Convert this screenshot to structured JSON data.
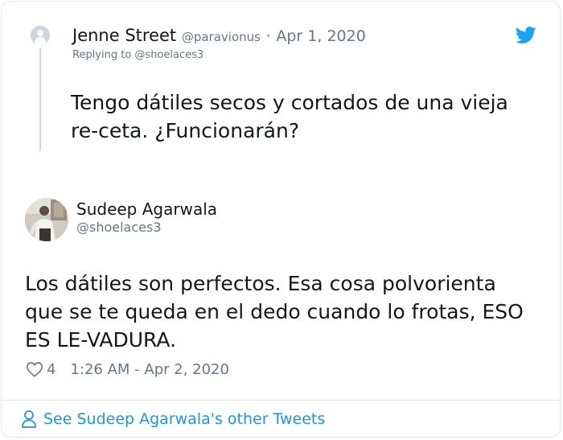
{
  "reply": {
    "name": "Jenne Street",
    "handle": "@paravionus",
    "separator": "·",
    "date": "Apr 1, 2020",
    "replying_to": "Replying to @shoelaces3",
    "text": "Tengo dátiles secos y cortados de una vieja re-ceta. ¿Funcionarán?"
  },
  "tweet": {
    "name": "Sudeep Agarwala",
    "handle": "@shoelaces3",
    "text": "Los dátiles son perfectos. Esa cosa polvorienta que se te queda en el dedo cuando lo frotas, ESO ES LE-VADURA.",
    "likes": "4",
    "timestamp": "1:26 AM - Apr 2, 2020"
  },
  "footer": {
    "see_more": "See Sudeep Agarwala's other Tweets"
  },
  "colors": {
    "twitter_blue": "#1da1f2",
    "link_blue": "#1b95e0",
    "secondary_text": "#657786",
    "border": "#e1e8ed"
  },
  "icons": [
    "default-avatar-icon",
    "twitter-bird-icon",
    "heart-icon",
    "person-icon"
  ]
}
